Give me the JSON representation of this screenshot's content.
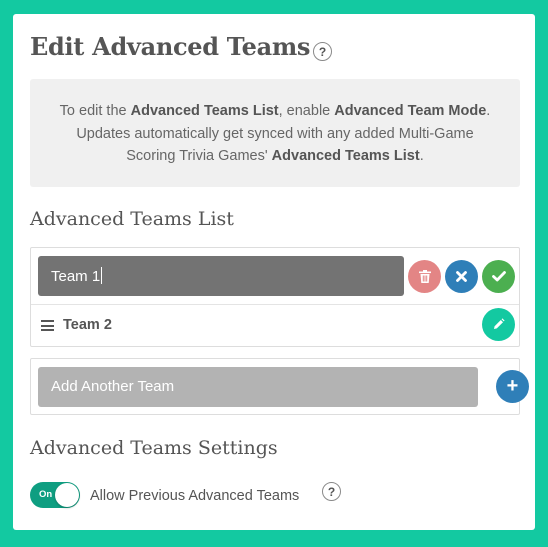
{
  "header": {
    "title": "Edit Advanced Teams",
    "help_glyph": "?"
  },
  "info": {
    "line1_pre": "To edit the ",
    "line1_b1": "Advanced Teams List",
    "line1_mid": ", enable ",
    "line1_b2": "Advanced Team Mode",
    "line1_post": ".",
    "line2": "Updates automatically get synced with any added Multi-Game",
    "line3_pre": "Scoring Trivia Games' ",
    "line3_b": "Advanced Teams List",
    "line3_post": "."
  },
  "teams_list": {
    "title": "Advanced Teams List",
    "editing_team_value": "Team 1",
    "teams": [
      {
        "name": "Team 2"
      }
    ],
    "icons": {
      "delete": "trash-icon",
      "cancel": "close-icon",
      "confirm": "check-icon",
      "edit": "pencil-icon",
      "drag": "drag-handle-icon"
    },
    "colors": {
      "delete": "#e38585",
      "cancel": "#2f7fb8",
      "confirm": "#4caf50",
      "edit": "#13c9a1",
      "editing_input": "#737373"
    }
  },
  "add_team": {
    "placeholder": "Add Another Team",
    "button_glyph": "+",
    "button_color": "#2f7fb8"
  },
  "settings": {
    "title": "Advanced Teams Settings",
    "allow_previous": {
      "toggle_label": "On",
      "toggle_on": true,
      "label": "Allow Previous Advanced Teams",
      "help_glyph": "?"
    }
  },
  "theme": {
    "background": "#13c9a1",
    "toggle_on_color": "#0f9e81"
  }
}
